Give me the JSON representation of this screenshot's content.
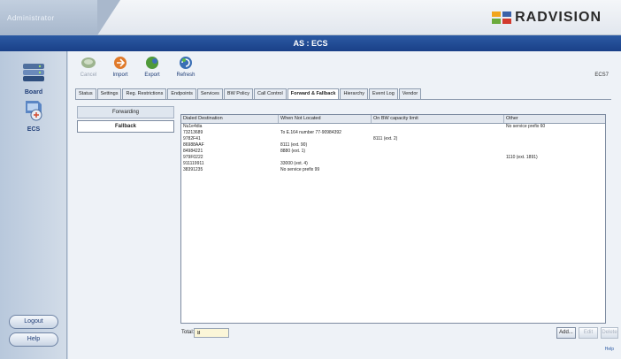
{
  "header": {
    "admin_label": "Administrator",
    "logo_text": "RADVISION",
    "title": "AS : ECS",
    "colors": {
      "title_bar": "#1f4a95",
      "logo_orange": "#f2a51c",
      "logo_blue": "#3b62a8",
      "logo_green": "#6cab3c",
      "logo_red": "#d23a2e"
    }
  },
  "sidebar": {
    "items": [
      {
        "label": "Board",
        "icon": "board-icon"
      },
      {
        "label": "ECS",
        "icon": "ecs-icon"
      }
    ],
    "logout_label": "Logout",
    "help_label": "Help"
  },
  "toolbar": {
    "buttons": [
      {
        "label": "Cancel",
        "icon": "cancel-icon",
        "enabled": false
      },
      {
        "label": "Import",
        "icon": "import-icon",
        "enabled": true
      },
      {
        "label": "Export",
        "icon": "export-icon",
        "enabled": true
      },
      {
        "label": "Refresh",
        "icon": "refresh-icon",
        "enabled": true
      }
    ],
    "device_id": "ECS7"
  },
  "tabs": [
    {
      "label": "Status",
      "active": false
    },
    {
      "label": "Settings",
      "active": false
    },
    {
      "label": "Reg. Restrictions",
      "active": false
    },
    {
      "label": "Endpoints",
      "active": false
    },
    {
      "label": "Services",
      "active": false
    },
    {
      "label": "BW Policy",
      "active": false
    },
    {
      "label": "Call Control",
      "active": false
    },
    {
      "label": "Forward & Fallback",
      "active": true
    },
    {
      "label": "Hierarchy",
      "active": false
    },
    {
      "label": "Event Log",
      "active": false
    },
    {
      "label": "Vendor",
      "active": false
    }
  ],
  "subnav": [
    {
      "label": "Forwarding",
      "active": false
    },
    {
      "label": "Fallback",
      "active": true
    }
  ],
  "grid": {
    "columns": [
      "Dialed Destination",
      "When Not Located",
      "On BW capacity limit",
      "Other"
    ],
    "rows": [
      [
        "Nu1e4dia",
        "",
        "",
        "No service prefix 60"
      ],
      [
        "73213689",
        "To E.164 number 77-90984392",
        "",
        ""
      ],
      [
        "9782F41",
        "",
        "8111 (ext. 2)",
        ""
      ],
      [
        "86988AAF",
        "8111 (ext. 90)",
        "",
        ""
      ],
      [
        "84984221",
        "8880 (ext. 1)",
        "",
        ""
      ],
      [
        "979F0222",
        "",
        "",
        "1110 (ext. 1891)"
      ],
      [
        "911119911",
        "33000 (ext. 4)",
        "",
        ""
      ],
      [
        "38391235",
        "No service prefix 99",
        "",
        ""
      ]
    ]
  },
  "footer": {
    "total_label": "Total:",
    "total_value": "8",
    "add_label": "Add...",
    "edit_label": "Edit",
    "delete_label": "Delete",
    "help_link": "Help"
  }
}
